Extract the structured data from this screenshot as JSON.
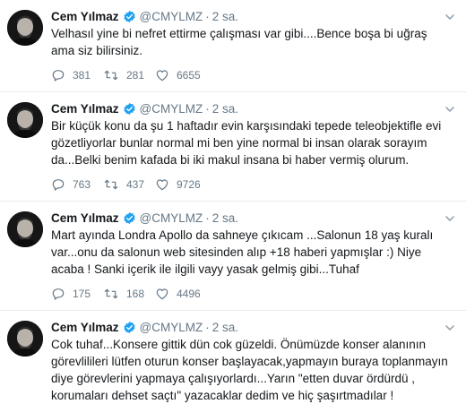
{
  "tweets": [
    {
      "author": "Cem Yılmaz",
      "handle": "@CMYLMZ",
      "separator": "·",
      "time": "2 sa.",
      "text": "Velhasıl yine bi nefret ettirme çalışması var gibi....Bence boşa bi uğraş ama siz bilirsiniz.",
      "replies": "381",
      "retweets": "281",
      "likes": "6655"
    },
    {
      "author": "Cem Yılmaz",
      "handle": "@CMYLMZ",
      "separator": "·",
      "time": "2 sa.",
      "text": "Bir küçük konu da şu 1 haftadır evin karşısındaki tepede teleobjektifle evi gözetliyorlar bunlar normal mi ben yine normal bi insan olarak sorayım da...Belki benim kafada bi iki makul insana bi haber vermiş olurum.",
      "replies": "763",
      "retweets": "437",
      "likes": "9726"
    },
    {
      "author": "Cem Yılmaz",
      "handle": "@CMYLMZ",
      "separator": "·",
      "time": "2 sa.",
      "text": "Mart ayında Londra Apollo da sahneye çıkıcam ...Salonun 18 yaş kuralı var...onu da salonun web sitesinden alıp +18 haberi yapmışlar :) Niye acaba !  Sanki içerik ile ilgili vayy yasak gelmiş gibi...Tuhaf",
      "replies": "175",
      "retweets": "168",
      "likes": "4496"
    },
    {
      "author": "Cem Yılmaz",
      "handle": "@CMYLMZ",
      "separator": "·",
      "time": "2 sa.",
      "text": "Cok tuhaf...Konsere gittik dün cok güzeldi. Önümüzde konser alanının görevlilileri lütfen oturun konser başlayacak,yapmayın buraya toplanmayın diye görevlerini yapmaya çalışıyorlardı...Yarın \"etten duvar ördürdü , korumaları dehset saçtı\" yazacaklar dedim ve hiç şaşırtmadılar !",
      "replies": "",
      "retweets": "",
      "likes": ""
    }
  ],
  "icons": {
    "verified": "verified-badge-icon",
    "caret": "chevron-down-icon",
    "reply": "reply-icon",
    "retweet": "retweet-icon",
    "like": "heart-icon"
  },
  "colors": {
    "verified": "#1da1f2",
    "text": "#14171a",
    "secondary": "#657786",
    "divider": "#e6ecf0"
  }
}
